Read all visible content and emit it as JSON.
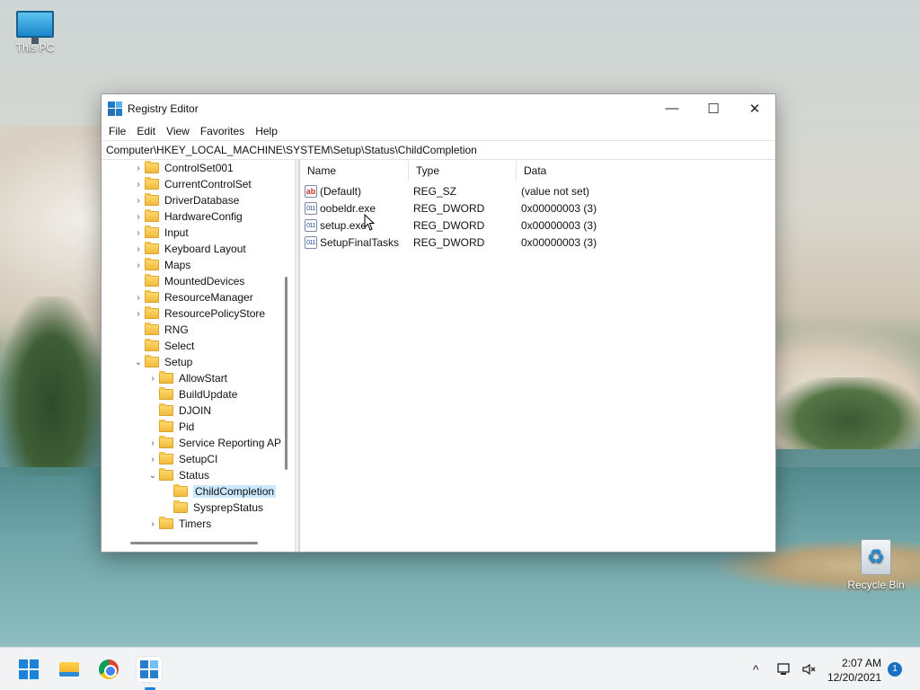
{
  "desktop": {
    "icons": [
      {
        "label": "This PC",
        "icon": "computer-icon"
      },
      {
        "label": "Recycle Bin",
        "icon": "recycle-bin-icon"
      }
    ]
  },
  "window": {
    "title": "Registry Editor",
    "controls": {
      "minimize": "—",
      "maximize": "☐",
      "close": "✕"
    },
    "menu": [
      "File",
      "Edit",
      "View",
      "Favorites",
      "Help"
    ],
    "address": "Computer\\HKEY_LOCAL_MACHINE\\SYSTEM\\Setup\\Status\\ChildCompletion"
  },
  "tree": {
    "items": [
      {
        "label": "ControlSet001",
        "caret": "›"
      },
      {
        "label": "CurrentControlSet",
        "caret": "›"
      },
      {
        "label": "DriverDatabase",
        "caret": "›"
      },
      {
        "label": "HardwareConfig",
        "caret": "›"
      },
      {
        "label": "Input",
        "caret": "›"
      },
      {
        "label": "Keyboard Layout",
        "caret": "›"
      },
      {
        "label": "Maps",
        "caret": "›"
      },
      {
        "label": "MountedDevices",
        "caret": ""
      },
      {
        "label": "ResourceManager",
        "caret": "›"
      },
      {
        "label": "ResourcePolicyStore",
        "caret": "›"
      },
      {
        "label": "RNG",
        "caret": ""
      },
      {
        "label": "Select",
        "caret": ""
      },
      {
        "label": "Setup",
        "caret": "⌄"
      },
      {
        "label": "AllowStart",
        "caret": "›"
      },
      {
        "label": "BuildUpdate",
        "caret": ""
      },
      {
        "label": "DJOIN",
        "caret": ""
      },
      {
        "label": "Pid",
        "caret": ""
      },
      {
        "label": "Service Reporting AP",
        "caret": "›"
      },
      {
        "label": "SetupCI",
        "caret": "›"
      },
      {
        "label": "Status",
        "caret": "⌄"
      },
      {
        "label": "ChildCompletion",
        "caret": ""
      },
      {
        "label": "SysprepStatus",
        "caret": ""
      },
      {
        "label": "Timers",
        "caret": "›"
      }
    ],
    "selected": "ChildCompletion"
  },
  "values": {
    "columns": [
      "Name",
      "Type",
      "Data"
    ],
    "rows": [
      {
        "name": "(Default)",
        "type": "REG_SZ",
        "data": "(value not set)",
        "icon": "string-value-icon",
        "glyph": "ab"
      },
      {
        "name": "oobeldr.exe",
        "type": "REG_DWORD",
        "data": "0x00000003 (3)",
        "icon": "binary-value-icon",
        "glyph": "011"
      },
      {
        "name": "setup.exe",
        "type": "REG_DWORD",
        "data": "0x00000003 (3)",
        "icon": "binary-value-icon",
        "glyph": "011"
      },
      {
        "name": "SetupFinalTasks",
        "type": "REG_DWORD",
        "data": "0x00000003 (3)",
        "icon": "binary-value-icon",
        "glyph": "011"
      }
    ]
  },
  "taskbar": {
    "apps": [
      "start-icon",
      "file-explorer-icon",
      "chrome-icon",
      "registry-editor-icon"
    ],
    "tray": {
      "chevron": "^",
      "time": "2:07 AM",
      "date": "12/20/2021",
      "notifications": "1"
    }
  }
}
